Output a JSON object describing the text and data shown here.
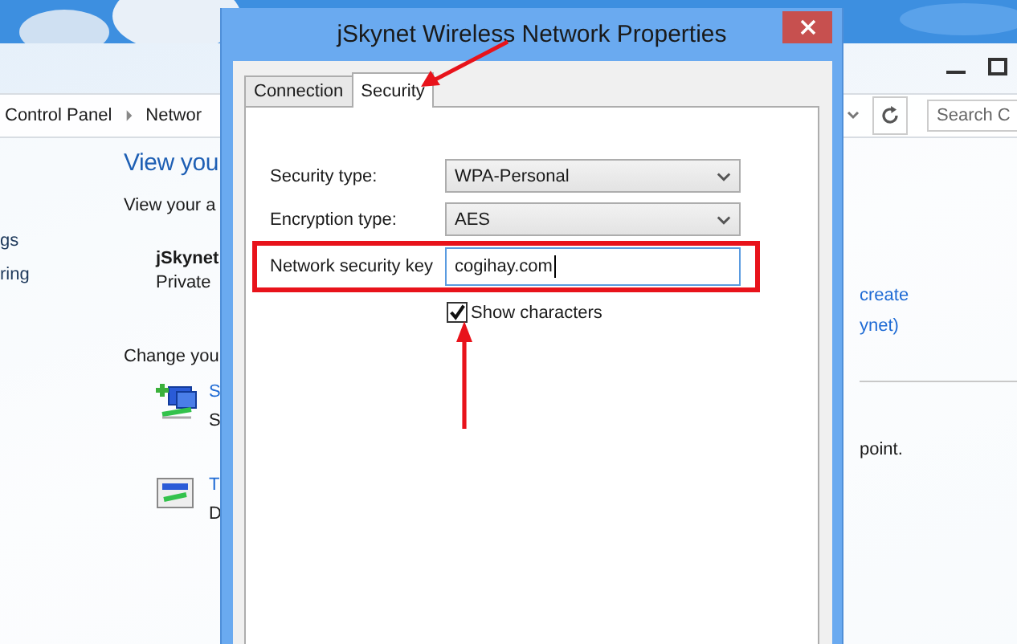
{
  "background_window": {
    "breadcrumb": [
      {
        "label": "Control Panel"
      },
      {
        "label": "Networ"
      }
    ],
    "search": {
      "placeholder": "Search C"
    },
    "left_pane": [
      "gs",
      "ring"
    ],
    "heading": "View you",
    "subheading": "View your a",
    "network": {
      "name": "jSkynet",
      "category": "Private"
    },
    "right_links": [
      "create",
      "ynet)"
    ],
    "change_heading": "Change you",
    "tasks": [
      {
        "kind": "add-network",
        "title": "S",
        "desc": "S"
      },
      {
        "kind": "troubleshoot",
        "title": "T",
        "desc": "D"
      }
    ],
    "note": "point."
  },
  "dialog": {
    "title": "jSkynet Wireless Network Properties",
    "tabs": [
      {
        "label": "Connection",
        "selected": false
      },
      {
        "label": "Security",
        "selected": true
      }
    ],
    "fields": [
      {
        "kind": "dropdown",
        "label": "Security type:",
        "value": "WPA-Personal",
        "highlighted": false
      },
      {
        "kind": "dropdown",
        "label": "Encryption type:",
        "value": "AES",
        "highlighted": false
      },
      {
        "kind": "text",
        "label": "Network security key",
        "value": "cogihay.com",
        "highlighted": true
      }
    ],
    "show_characters": {
      "label": "Show characters",
      "checked": true
    }
  }
}
